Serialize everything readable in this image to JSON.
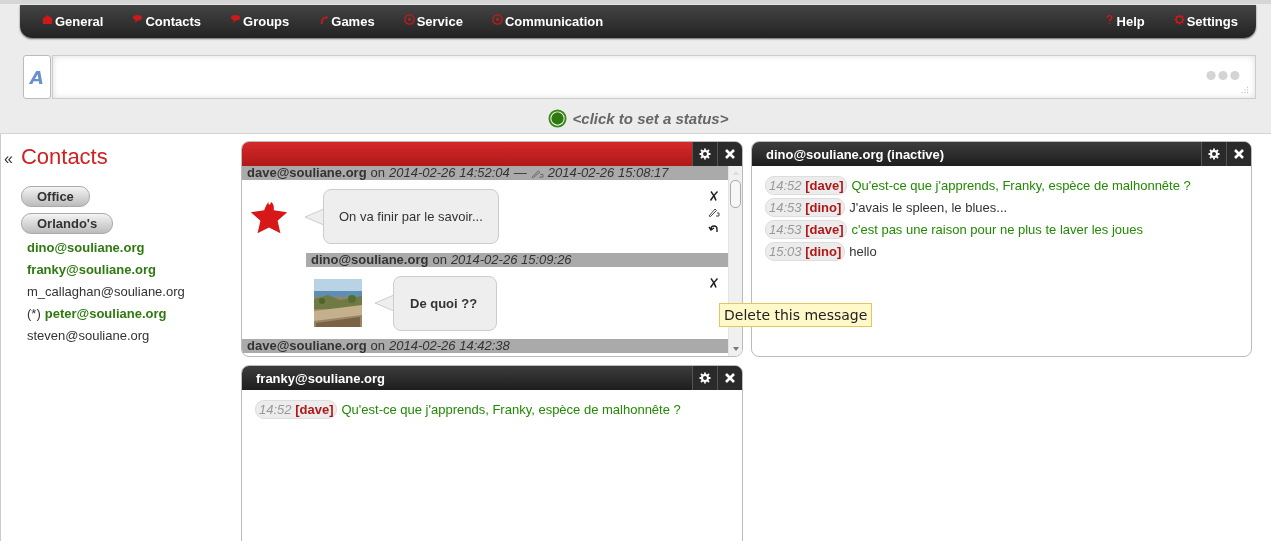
{
  "nav": {
    "left": [
      {
        "label": "General"
      },
      {
        "label": "Contacts"
      },
      {
        "label": "Groups"
      },
      {
        "label": "Games"
      },
      {
        "label": "Service"
      },
      {
        "label": "Communication"
      }
    ],
    "right": [
      {
        "label": "Help"
      },
      {
        "label": "Settings"
      }
    ]
  },
  "composer": {
    "button": "A"
  },
  "status": {
    "text": "<click to set a status>"
  },
  "contacts": {
    "collapse": "«",
    "title": "Contacts",
    "groups": [
      "Office",
      "Orlando's"
    ],
    "items": [
      {
        "name": "dino@souliane.org",
        "online": true
      },
      {
        "name": "franky@souliane.org",
        "online": true
      },
      {
        "name": "m_callaghan@souliane.org",
        "online": false
      },
      {
        "prefix": "(*)",
        "name": "peter@souliane.org",
        "online": true
      },
      {
        "name": "steven@souliane.org",
        "online": false
      }
    ]
  },
  "group_panel": {
    "focused": true,
    "messages": [
      {
        "author": "dave@souliane.org",
        "on": "on",
        "date": "2014-02-26 14:52:04",
        "separator": "—",
        "edited": "2014-02-26 15:08:17",
        "indent": false,
        "avatar": {
          "kind": "star"
        },
        "text": "On va finir par le savoir...",
        "bold": false,
        "actions": [
          {
            "kind": "delete"
          },
          {
            "kind": "edit"
          },
          {
            "kind": "undo"
          }
        ]
      },
      {
        "author": "dino@souliane.org",
        "on": "on",
        "date": "2014-02-26 15:09:26",
        "indent": true,
        "avatar": {
          "kind": "picture"
        },
        "text": "De quoi ??",
        "bold": true,
        "actions": [
          {
            "kind": "delete"
          }
        ]
      },
      {
        "author": "dave@souliane.org",
        "on": "on",
        "date": "2014-02-26 14:42:38",
        "indent": false
      }
    ]
  },
  "chat_panels": [
    {
      "title": "dino@souliane.org (inactive)",
      "focused": false,
      "lines": [
        {
          "time": "14:52",
          "nick": "[dave]",
          "text": "Qu'est-ce que j'apprends, Franky, espèce de malhonnête ?",
          "own": true
        },
        {
          "time": "14:53",
          "nick": "[dino]",
          "text": "J'avais le spleen, le blues...",
          "own": false
        },
        {
          "time": "14:53",
          "nick": "[dave]",
          "text": "c'est pas une raison pour ne plus te laver les joues",
          "own": true
        },
        {
          "time": "15:03",
          "nick": "[dino]",
          "text": "hello",
          "own": false
        }
      ]
    },
    {
      "title": "franky@souliane.org",
      "focused": false,
      "lines": [
        {
          "time": "14:52",
          "nick": "[dave]",
          "text": "Qu'est-ce que j'apprends, Franky, espèce de malhonnête ?",
          "own": true
        }
      ]
    }
  ],
  "tooltip": {
    "text": "Delete this message"
  }
}
